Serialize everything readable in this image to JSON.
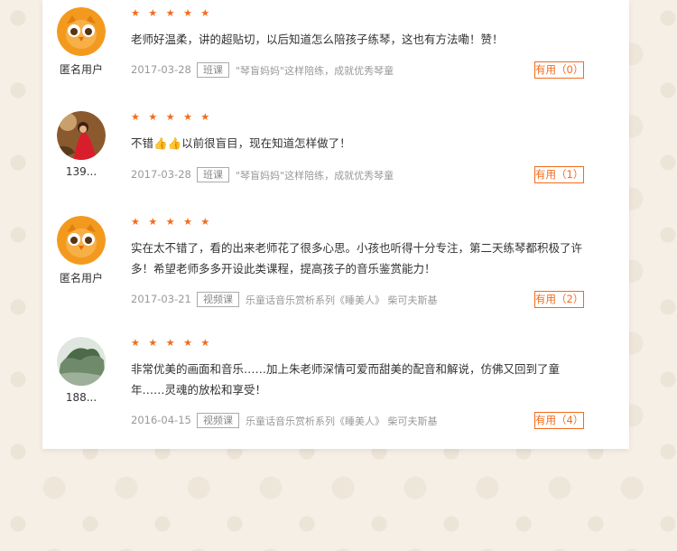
{
  "reviews": [
    {
      "user": "匿名用户",
      "avatar": "owl-avatar",
      "stars": "★ ★ ★ ★ ★",
      "text": "老师好温柔，讲的超贴切，以后知道怎么陪孩子练琴，这也有方法嘞！赞！",
      "date": "2017-03-28",
      "tag": "班课",
      "course": "\"琴盲妈妈\"这样陪练，成就优秀琴童",
      "useful": "有用（0）"
    },
    {
      "user": "139...",
      "avatar": "photo-avatar-red",
      "stars": "★ ★ ★ ★ ★",
      "text": "不错👍👍以前很盲目，现在知道怎样做了！",
      "date": "2017-03-28",
      "tag": "班课",
      "course": "\"琴盲妈妈\"这样陪练，成就优秀琴童",
      "useful": "有用（1）"
    },
    {
      "user": "匿名用户",
      "avatar": "owl-avatar",
      "stars": "★ ★ ★ ★ ★",
      "text": "实在太不错了，看的出来老师花了很多心思。小孩也听得十分专注，第二天练琴都积极了许多！希望老师多多开设此类课程，提高孩子的音乐鉴赏能力！",
      "date": "2017-03-21",
      "tag": "视频课",
      "course": "乐童话音乐赏析系列《睡美人》 柴可夫斯基",
      "useful": "有用（2）"
    },
    {
      "user": "188...",
      "avatar": "photo-avatar-landscape",
      "stars": "★ ★ ★ ★ ★",
      "text": "非常优美的画面和音乐……加上朱老师深情可爱而甜美的配音和解说，仿佛又回到了童年……灵魂的放松和享受！",
      "date": "2016-04-15",
      "tag": "视频课",
      "course": "乐童话音乐赏析系列《睡美人》 柴可夫斯基",
      "useful": "有用（4）"
    }
  ],
  "colors": {
    "accent": "#f26b1d",
    "text": "#333333",
    "muted": "#999999"
  }
}
